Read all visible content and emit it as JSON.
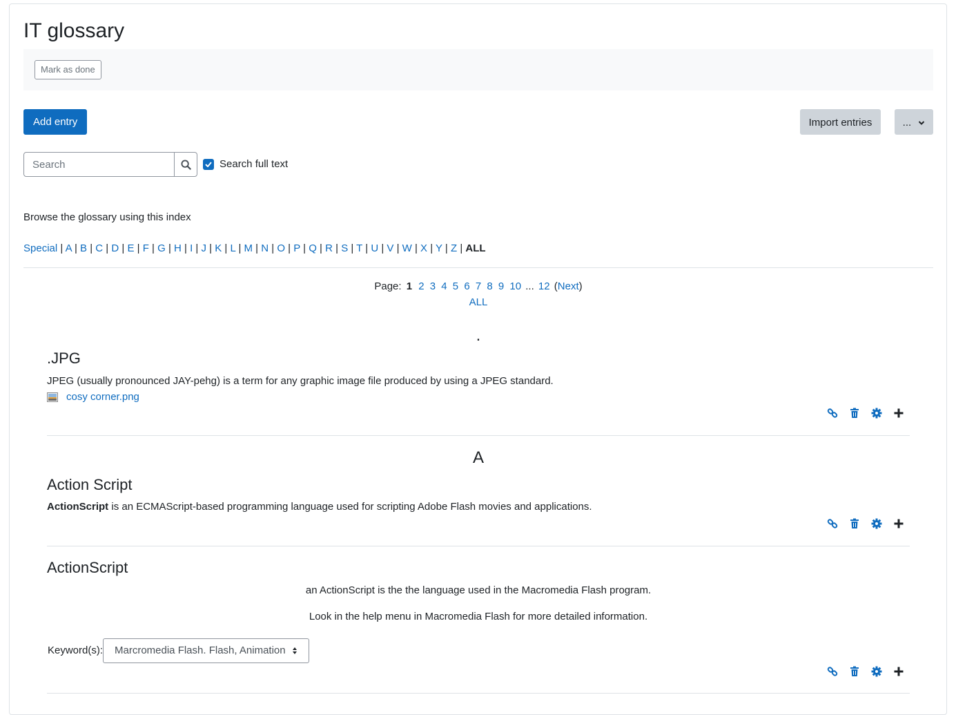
{
  "page": {
    "title": "IT glossary",
    "mark_done_label": "Mark as done",
    "add_entry_label": "Add entry",
    "import_entries_label": "Import entries",
    "more_label": "..."
  },
  "search": {
    "placeholder": "Search",
    "full_text_label": "Search full text",
    "full_text_checked": true
  },
  "browse": {
    "label": "Browse the glossary using this index",
    "special": "Special",
    "letters": [
      "A",
      "B",
      "C",
      "D",
      "E",
      "F",
      "G",
      "H",
      "I",
      "J",
      "K",
      "L",
      "M",
      "N",
      "O",
      "P",
      "Q",
      "R",
      "S",
      "T",
      "U",
      "V",
      "W",
      "X",
      "Y",
      "Z"
    ],
    "current": "ALL"
  },
  "paging": {
    "label": "Page:",
    "current": "1",
    "pages": [
      "2",
      "3",
      "4",
      "5",
      "6",
      "7",
      "8",
      "9",
      "10"
    ],
    "ellipsis": "...",
    "last": "12",
    "next_open": "(",
    "next": "Next",
    "next_close": ")",
    "all": "ALL"
  },
  "sections": [
    {
      "heading": ".",
      "entries": [
        {
          "concept": ".JPG",
          "definition": "JPEG (usually pronounced JAY-pehg) is a term for any graphic image file produced by using a JPEG standard.",
          "attachment": "cosy corner.png"
        }
      ]
    },
    {
      "heading": "A",
      "entries": [
        {
          "concept": "Action Script",
          "definition_bold": "ActionScript",
          "definition_rest": " is an ECMAScript-based programming language used for scripting Adobe Flash movies and applications."
        },
        {
          "concept": "ActionScript",
          "definition_lines": [
            "an ActionScript is the the language used in the Macromedia Flash program.",
            "Look in the help menu in Macromedia Flash for more detailed information."
          ],
          "keywords_label": "Keyword(s):",
          "keywords_value": "Marcromedia Flash. Flash, Animation"
        }
      ]
    }
  ],
  "colors": {
    "primary": "#0f6cbf",
    "secondary": "#ced4da",
    "text": "#1d2125"
  },
  "icons": {
    "entry_actions": [
      "link-icon",
      "trash-icon",
      "gear-icon",
      "plus-icon"
    ]
  }
}
